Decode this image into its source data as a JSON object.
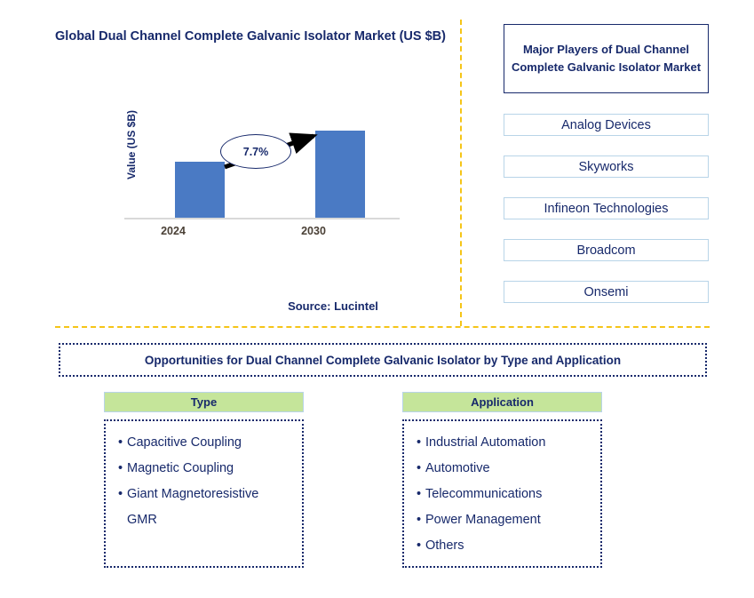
{
  "chart_panel": {
    "title": "Global Dual Channel Complete Galvanic Isolator Market (US $B)",
    "y_axis_label": "Value (US $B)",
    "cagr_label": "7.7%",
    "source": "Source: Lucintel"
  },
  "chart_data": {
    "type": "bar",
    "title": "Global Dual Channel Complete Galvanic Isolator Market (US $B)",
    "categories": [
      "2024",
      "2030"
    ],
    "values": [
      1.0,
      1.56
    ],
    "xlabel": "",
    "ylabel": "Value (US $B)",
    "ylim": [
      0,
      1.75
    ],
    "grid": false,
    "legend": null,
    "annotations": [
      {
        "text": "7.7%",
        "kind": "cagr-callout",
        "from": "2024",
        "to": "2030"
      }
    ],
    "bar_color": "#4a7ac4",
    "axis_color": "#d9d9d9",
    "tick_label_color": "#4a4036"
  },
  "players_panel": {
    "header": "Major Players of Dual Channel Complete Galvanic Isolator Market",
    "items": [
      {
        "label": "Analog Devices"
      },
      {
        "label": "Skyworks"
      },
      {
        "label": "Infineon Technologies"
      },
      {
        "label": "Broadcom"
      },
      {
        "label": "Onsemi"
      }
    ]
  },
  "opportunities": {
    "banner": "Opportunities for Dual Channel Complete Galvanic Isolator by Type and Application",
    "columns": [
      {
        "header": "Type",
        "items": [
          {
            "text": "Capacitive Coupling",
            "continuation": false
          },
          {
            "text": "Magnetic Coupling",
            "continuation": false
          },
          {
            "text": "Giant Magnetoresistive",
            "continuation": false
          },
          {
            "text": "GMR",
            "continuation": true
          }
        ]
      },
      {
        "header": "Application",
        "items": [
          {
            "text": "Industrial Automation",
            "continuation": false
          },
          {
            "text": "Automotive",
            "continuation": false
          },
          {
            "text": "Telecommunications",
            "continuation": false
          },
          {
            "text": "Power Management",
            "continuation": false
          },
          {
            "text": "Others",
            "continuation": false
          }
        ]
      }
    ]
  },
  "theme": {
    "navy": "#17296b",
    "bar_blue": "#4a7ac4",
    "divider_gold": "#f5c518",
    "header_green": "#c5e59a",
    "box_border_blue": "#b8d4e8"
  }
}
